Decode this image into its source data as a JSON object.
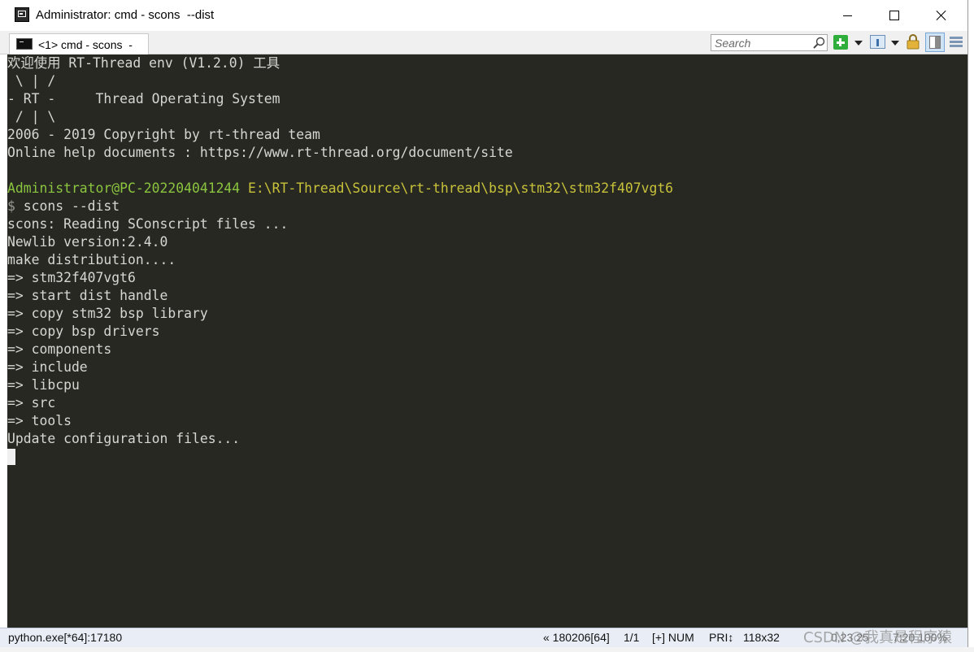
{
  "window": {
    "title": "Administrator: cmd - scons  --dist",
    "icon": "console-app-icon"
  },
  "tabs": [
    {
      "label": "<1> cmd - scons  -",
      "icon": "console-tab-icon"
    }
  ],
  "toolbar": {
    "search_placeholder": "Search"
  },
  "console": {
    "lines": [
      {
        "text": "欢迎使用 RT-Thread env (V1.2.0) 工具"
      },
      {
        "text": " \\ | /"
      },
      {
        "text": "- RT -     Thread Operating System"
      },
      {
        "text": " / | \\"
      },
      {
        "text": "2006 - 2019 Copyright by rt-thread team"
      },
      {
        "text": "Online help documents : https://www.rt-thread.org/document/site"
      },
      {
        "text": ""
      },
      {
        "user": "Administrator@PC-202204041244",
        "path": "E:\\RT-Thread\\Source\\rt-thread\\bsp\\stm32\\stm32f407vgt6"
      },
      {
        "prompt": "$",
        "cmd": " scons --dist"
      },
      {
        "text": "scons: Reading SConscript files ..."
      },
      {
        "text": "Newlib version:2.4.0"
      },
      {
        "text": "make distribution...."
      },
      {
        "text": "=> stm32f407vgt6"
      },
      {
        "text": "=> start dist handle"
      },
      {
        "text": "=> copy stm32 bsp library"
      },
      {
        "text": "=> copy bsp drivers"
      },
      {
        "text": "=> components"
      },
      {
        "text": "=> include"
      },
      {
        "text": "=> libcpu"
      },
      {
        "text": "=> src"
      },
      {
        "text": "=> tools"
      },
      {
        "text": "Update configuration files..."
      }
    ]
  },
  "statusbar": {
    "process": "python.exe[*64]:17180",
    "position": "« 180206[64]",
    "pages": "1/1",
    "mode": "[+] NUM",
    "pri": "PRI↕",
    "size": "118x32",
    "coords": "0,23 25",
    "extra": "7:20 100%"
  },
  "watermark": "CSDN @我真是程序猿",
  "colors": {
    "console_bg": "#272822",
    "console_fg": "#d6d6d2",
    "prompt_user": "#8bc53f",
    "prompt_path": "#c8c23a"
  }
}
